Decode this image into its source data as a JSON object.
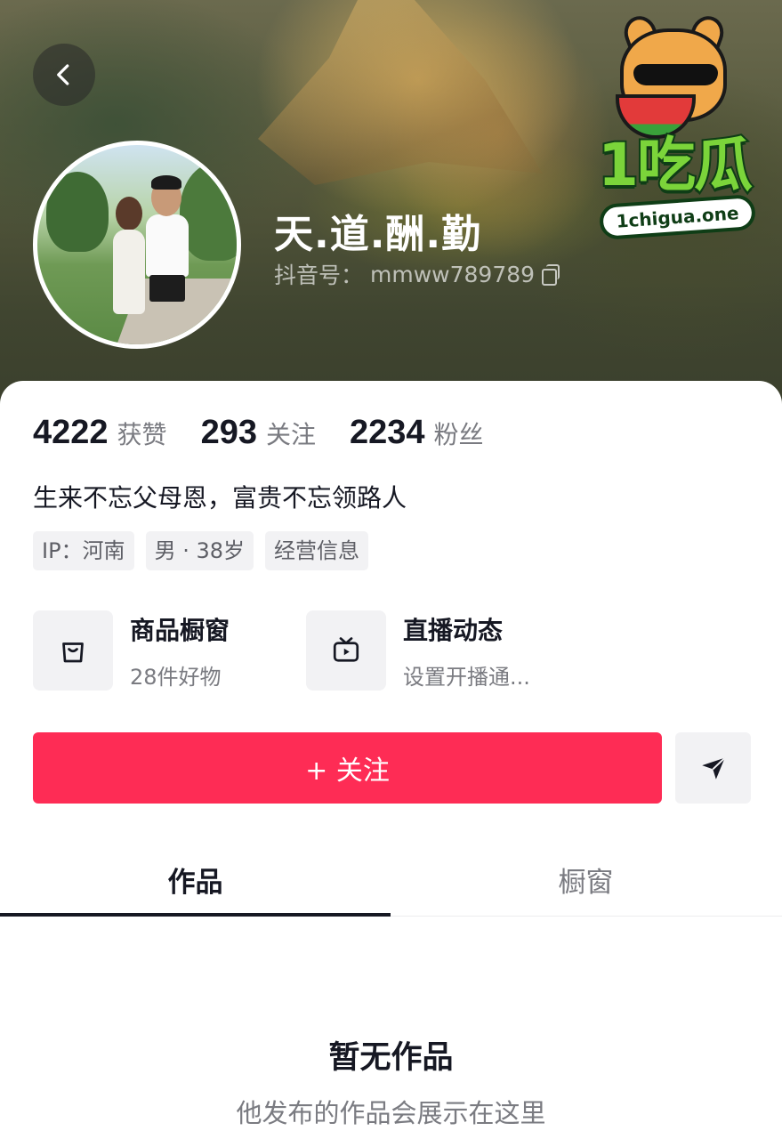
{
  "profile": {
    "nickname": "天.道.酬.勤",
    "douyin_id_label": "抖音号：",
    "douyin_id": "mmww789789"
  },
  "watermark": {
    "brand": "1吃瓜",
    "domain": "1chigua.one"
  },
  "stats": [
    {
      "value": "4222",
      "label": "获赞"
    },
    {
      "value": "293",
      "label": "关注"
    },
    {
      "value": "2234",
      "label": "粉丝"
    }
  ],
  "bio": "生来不忘父母恩，富贵不忘领路人",
  "tags": [
    "IP：河南",
    "男 · 38岁",
    "经营信息"
  ],
  "features": [
    {
      "icon": "shopping-bag-icon",
      "title": "商品橱窗",
      "subtitle": "28件好物"
    },
    {
      "icon": "tv-live-icon",
      "title": "直播动态",
      "subtitle": "设置开播通..."
    }
  ],
  "actions": {
    "follow_label": "+ 关注",
    "share_icon": "send-icon"
  },
  "tabs": [
    {
      "label": "作品",
      "active": true
    },
    {
      "label": "橱窗",
      "active": false
    }
  ],
  "empty_state": {
    "title": "暂无作品",
    "subtitle": "他发布的作品会展示在这里"
  },
  "colors": {
    "accent": "#fe2c55",
    "text_primary": "#161823",
    "text_secondary": "#7a7b81",
    "chip_bg": "#f2f2f4"
  }
}
